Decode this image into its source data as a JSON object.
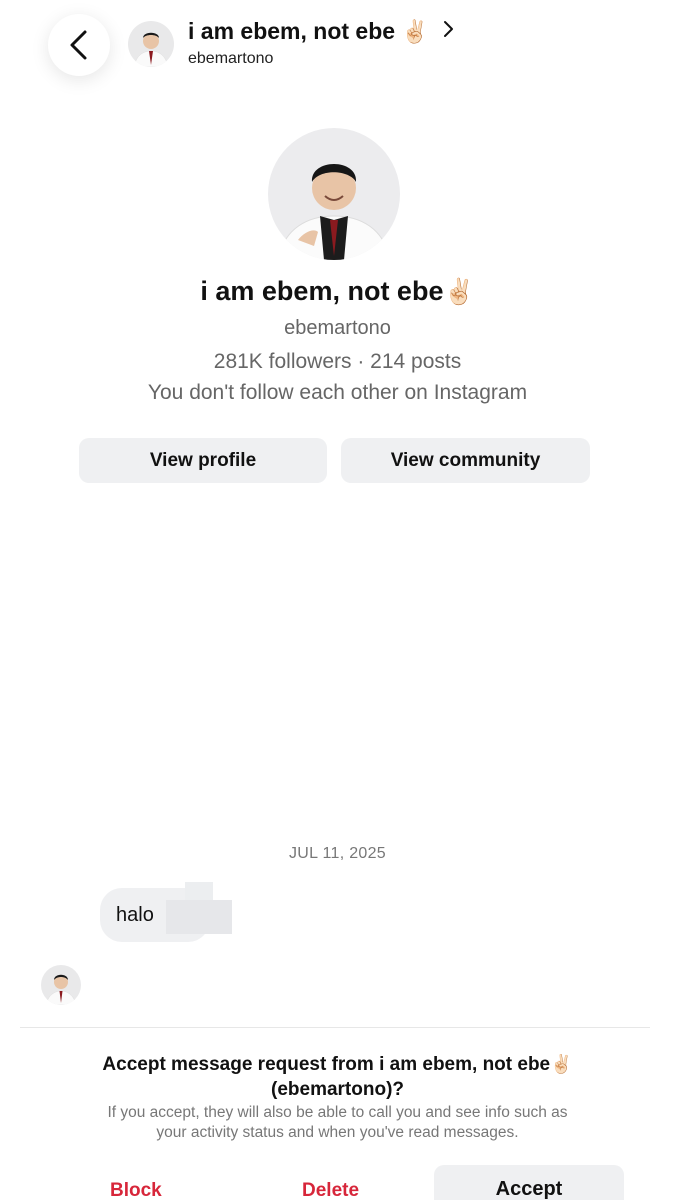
{
  "header": {
    "name": "i am ebem, not ebe",
    "name_emoji": "✌🏻",
    "chevron": "›",
    "username": "ebemartono"
  },
  "profile": {
    "name": "i am ebem, not ebe",
    "name_emoji": "✌🏻",
    "username": "ebemartono",
    "stats": "281K followers · 214 posts",
    "follow_status": "You don't follow each other on Instagram",
    "view_profile_label": "View profile",
    "view_community_label": "View community"
  },
  "chat": {
    "date": "JUL 11, 2025",
    "messages": [
      {
        "text": "halo"
      }
    ]
  },
  "request": {
    "title_line1": "Accept message request from i am ebem, not ebe",
    "title_emoji": "✌🏻",
    "title_line2": "(ebemartono)?",
    "description_line1": "If you accept, they will also be able to call you and see info such as",
    "description_line2": "your activity status and when you've read messages.",
    "block_label": "Block",
    "delete_label": "Delete",
    "accept_label": "Accept"
  },
  "colors": {
    "danger": "#d7263a",
    "button_bg": "#eff0f2",
    "muted_text": "#666666"
  },
  "icons": {
    "back": "chevron-left-icon",
    "forward": "chevron-right-icon"
  }
}
